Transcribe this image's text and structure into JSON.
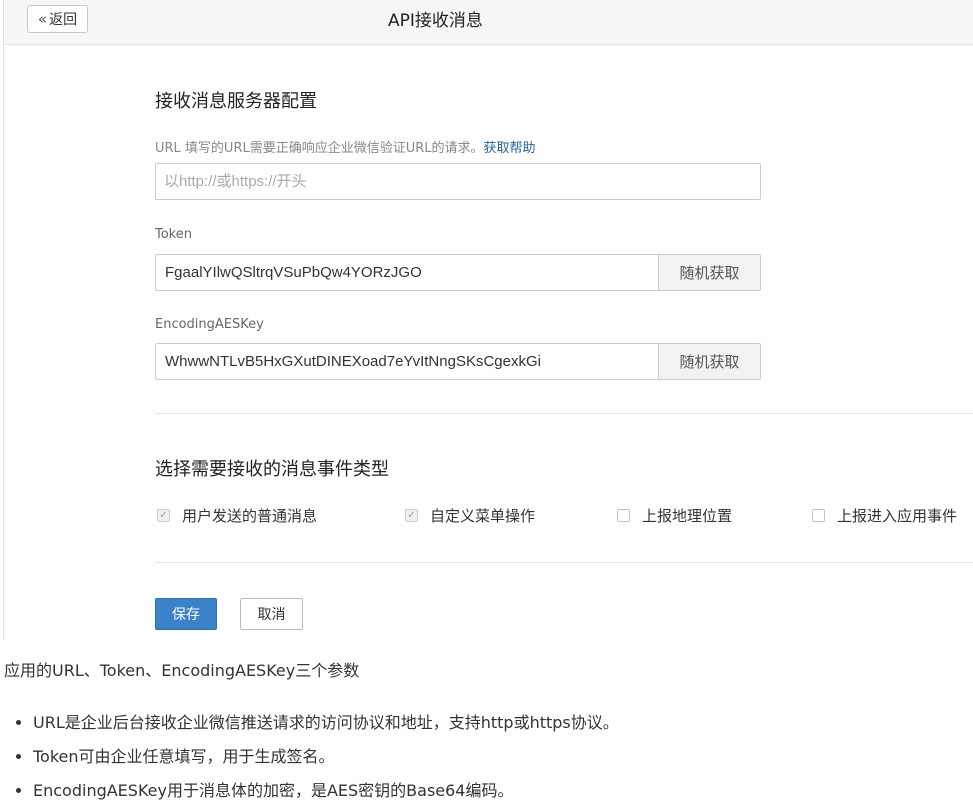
{
  "header": {
    "back_icon": "«",
    "back_label": "返回",
    "title": "API接收消息"
  },
  "server_config": {
    "section_title": "接收消息服务器配置",
    "url_hint": "URL  填写的URL需要正确响应企业微信验证URL的请求。",
    "help_link": "获取帮助",
    "url_value": "",
    "url_placeholder": "以http://或https://开头",
    "token_label": "Token",
    "token_value": "FgaalYIlwQSltrqVSuPbQw4YORzJGO",
    "aeskey_label": "EncodingAESKey",
    "aeskey_value": "WhwwNTLvB5HxGXutDINEXoad7eYvItNngSKsCgexkGi",
    "random_button": "随机获取"
  },
  "event_types": {
    "section_title": "选择需要接收的消息事件类型",
    "options": [
      {
        "label": "用户发送的普通消息",
        "checked": true
      },
      {
        "label": "自定义菜单操作",
        "checked": true
      },
      {
        "label": "上报地理位置",
        "checked": false
      },
      {
        "label": "上报进入应用事件",
        "checked": false
      }
    ]
  },
  "actions": {
    "save": "保存",
    "cancel": "取消"
  },
  "doc": {
    "intro": "应用的URL、Token、EncodingAESKey三个参数",
    "bullets": [
      "URL是企业后台接收企业微信推送请求的访问协议和地址，支持http或https协议。",
      "Token可由企业任意填写，用于生成签名。",
      "EncodingAESKey用于消息体的加密，是AES密钥的Base64编码。"
    ]
  },
  "colors": {
    "primary": "#3c82c8",
    "link": "#2a6496"
  }
}
